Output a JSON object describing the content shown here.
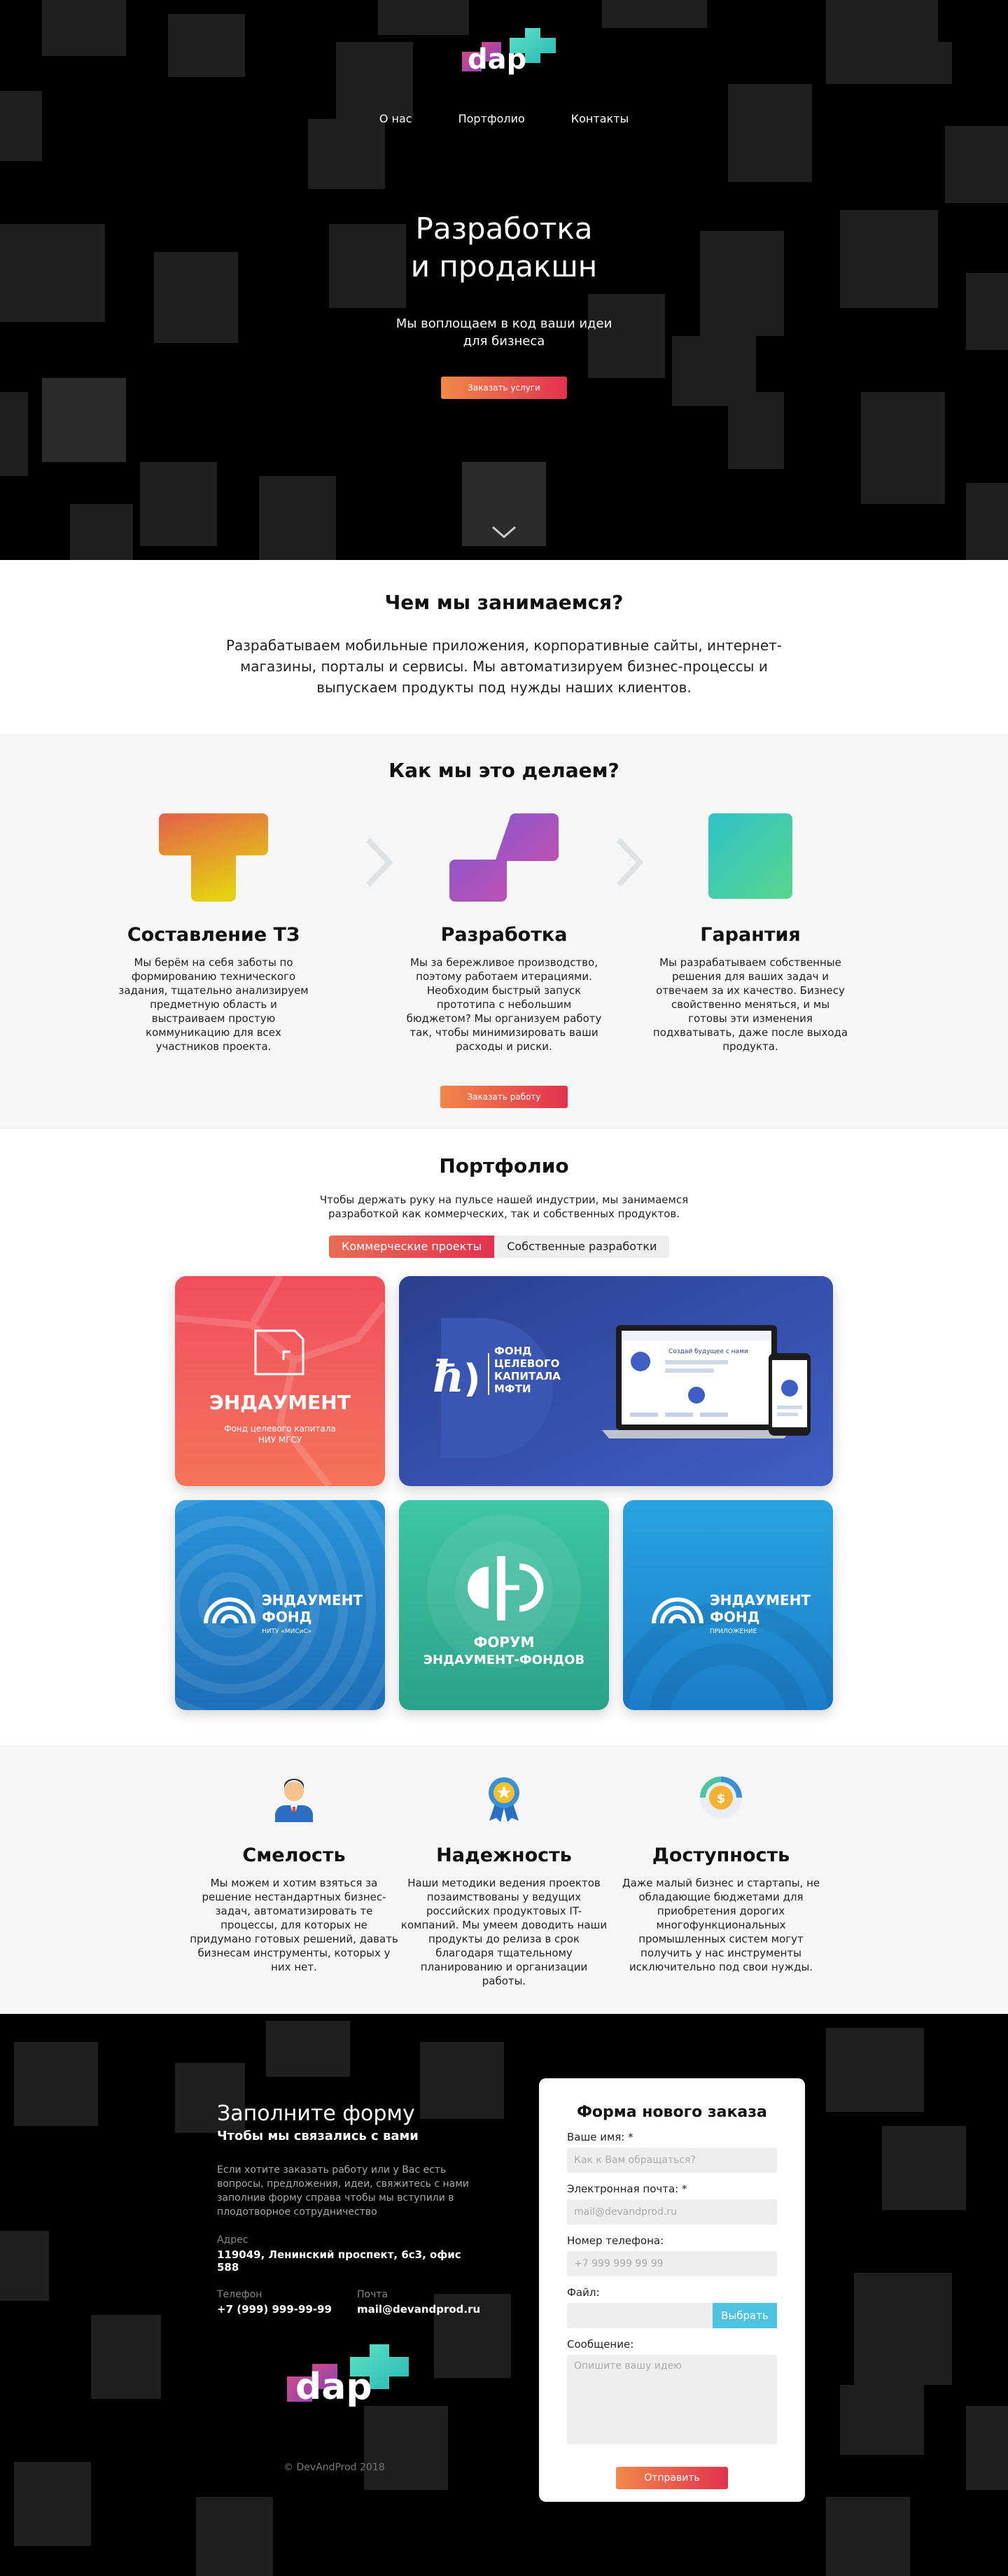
{
  "brand": {
    "logo_text": "dap"
  },
  "nav": {
    "about": "О нас",
    "portfolio": "Портфолио",
    "contacts": "Контакты"
  },
  "hero": {
    "title": "Разработка\nи продакшн",
    "subtitle": "Мы воплощаем в код ваши идеи\nдля бизнеса",
    "cta": "Заказать услуги"
  },
  "what": {
    "title": "Чем мы занимаемся?",
    "text": "Разрабатываем мобильные приложения, корпоративные сайты, интернет-магазины, порталы и сервисы. Мы автоматизируем бизнес-процессы и выпускаем продукты под нужды наших клиентов."
  },
  "how": {
    "title": "Как мы это делаем?",
    "steps": [
      {
        "title": "Составление ТЗ",
        "text": "Мы берём на себя заботы по формированию технического задания, тщательно анализируем предметную область и выстраиваем простую коммуникацию для всех участников проекта."
      },
      {
        "title": "Разработка",
        "text": "Мы за бережливое производство, поэтому работаем итерациями. Необходим быстрый запуск прототипа с небольшим бюджетом? Мы организуем работу так, чтобы минимизировать ваши расходы и риски."
      },
      {
        "title": "Гарантия",
        "text": "Мы разрабатываем собственные решения для ваших задач и отвечаем за их качество. Бизнесу свойственно меняться, и мы готовы эти изменения подхватывать, даже после выхода продукта."
      }
    ],
    "cta": "Заказать работу"
  },
  "portfolio": {
    "title": "Портфолио",
    "subtitle": "Чтобы держать руку на пульсе нашей индустрии, мы занимаемся разработкой как коммерческих, так и собственных продуктов.",
    "tab_active": "Коммерческие проекты",
    "tab_inactive": "Собственные разработки",
    "cards": {
      "c1": {
        "title": "ЭНДАУМЕНТ",
        "sub1": "Фонд целевого капитала",
        "sub2": "НИУ МГСУ"
      },
      "c2": {
        "line1": "ФОНД",
        "line2": "ЦЕЛЕВОГО",
        "line3": "КАПИТАЛА",
        "line4": "МФТИ",
        "screen_text": "Создай будущее с нами"
      },
      "c3": {
        "line1": "ЭНДАУМЕНТ",
        "line2": "ФОНД",
        "line3": "НИТУ «МИСиС»"
      },
      "c4": {
        "line1": "ФОРУМ",
        "line2": "ЭНДАУМЕНТ-ФОНДОВ"
      },
      "c5": {
        "line1": "ЭНДАУМЕНТ",
        "line2": "ФОНД",
        "line3": "ПРИЛОЖЕНИЕ"
      }
    }
  },
  "values": [
    {
      "title": "Смелость",
      "text": "Мы можем и хотим взяться за решение нестандартных бизнес-задач, автоматизировать те процессы, для которых не придумано готовых решений, давать бизнесам инструменты, которых у них нет.",
      "icon": "businessman-icon"
    },
    {
      "title": "Надежность",
      "text": "Наши методики ведения проектов позаимствованы у ведущих российских продуктовых IT-компаний. Мы умеем доводить наши продукты до релиза в срок благодаря тщательному планированию и организации работы.",
      "icon": "medal-icon"
    },
    {
      "title": "Доступность",
      "text": "Даже малый бизнес и стартапы, не обладающие бюджетами для приобретения дорогих многофункциональных промышленных систем могут получить у нас инструменты исключительно под свои нужды.",
      "icon": "coin-icon"
    }
  ],
  "footer": {
    "title": "Заполните форму",
    "subtitle": "Чтобы мы связались с вами",
    "desc": "Если хотите заказать работу или у Вас есть вопросы, предложения, идеи, свяжитесь с нами заполнив форму справа чтобы мы вступили в плодотворное сотрудничество",
    "address_label": "Адрес",
    "address": "119049, Ленинский проспект, 6с3, офис 588",
    "phone_label": "Телефон",
    "phone": "+7 (999) 999-99-99",
    "mail_label": "Почта",
    "mail": "mail@devandprod.ru",
    "copyright": "© DevAndProd 2018"
  },
  "form": {
    "title": "Форма нового заказа",
    "name_label": "Ваше имя: *",
    "name_placeholder": "Как к Вам обращаться?",
    "email_label": "Электронная почта: *",
    "email_placeholder": "mail@devandprod.ru",
    "phone_label": "Номер телефона:",
    "phone_placeholder": "+7 999 999 99 99",
    "file_label": "Файл:",
    "file_button": "Выбрать",
    "message_label": "Сообщение:",
    "message_placeholder": "Опишите вашу идею",
    "submit": "Отправить"
  },
  "colors": {
    "accent_from": "#f2884a",
    "accent_to": "#e2324f",
    "file_button": "#4ec3e0",
    "hero_bg": "#000000",
    "section_gray": "#f6f6f6"
  }
}
